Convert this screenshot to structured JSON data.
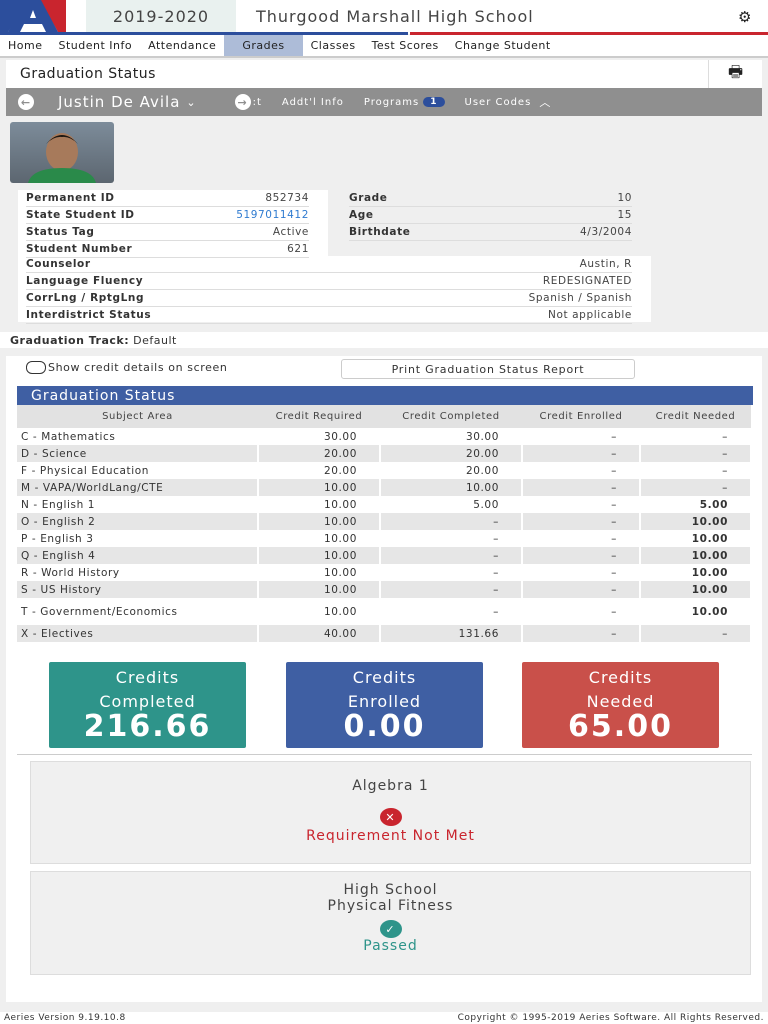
{
  "header": {
    "year": "2019-2020",
    "school": "Thurgood Marshall High School"
  },
  "nav": [
    "Home",
    "Student Info",
    "Attendance",
    "Grades",
    "Classes",
    "Test Scores",
    "Change Student"
  ],
  "page_title": "Graduation Status",
  "student_bar": {
    "name": "Justin De Avila",
    "contact_fragment": ":t",
    "addl_info": "Addt'l Info",
    "programs": "Programs",
    "programs_count": "1",
    "user_codes": "User Codes"
  },
  "info_left": [
    [
      "Permanent ID",
      "852734"
    ],
    [
      "State Student ID",
      "5197011412"
    ],
    [
      "Status Tag",
      "Active"
    ],
    [
      "Student Number",
      "621"
    ]
  ],
  "info_right": [
    [
      "Grade",
      "10"
    ],
    [
      "Age",
      "15"
    ],
    [
      "Birthdate",
      "4/3/2004"
    ]
  ],
  "info_wide": [
    [
      "Counselor",
      "Austin, R"
    ],
    [
      "Language Fluency",
      "REDESIGNATED"
    ],
    [
      "CorrLng / RptgLng",
      "Spanish / Spanish"
    ],
    [
      "Interdistrict Status",
      "Not applicable"
    ]
  ],
  "track": {
    "label": "Graduation Track:",
    "value": "Default"
  },
  "show_details": "Show credit details on screen",
  "print_report": "Print Graduation Status Report",
  "table": {
    "title": "Graduation Status",
    "headers": [
      "Subject Area",
      "Credit Required",
      "Credit Completed",
      "Credit Enrolled",
      "Credit Needed"
    ],
    "rows": [
      [
        "C - Mathematics",
        "30.00",
        "30.00",
        "–",
        "–"
      ],
      [
        "D - Science",
        "20.00",
        "20.00",
        "–",
        "–"
      ],
      [
        "F - Physical Education",
        "20.00",
        "20.00",
        "–",
        "–"
      ],
      [
        "M - VAPA/WorldLang/CTE",
        "10.00",
        "10.00",
        "–",
        "–"
      ],
      [
        "N - English 1",
        "10.00",
        "5.00",
        "–",
        "5.00"
      ],
      [
        "O - English 2",
        "10.00",
        "–",
        "–",
        "10.00"
      ],
      [
        "P - English 3",
        "10.00",
        "–",
        "–",
        "10.00"
      ],
      [
        "Q - English 4",
        "10.00",
        "–",
        "–",
        "10.00"
      ],
      [
        "R - World History",
        "10.00",
        "–",
        "–",
        "10.00"
      ],
      [
        "S - US History",
        "10.00",
        "–",
        "–",
        "10.00"
      ],
      [
        "T - Government/Economics",
        "10.00",
        "–",
        "–",
        "10.00"
      ],
      [
        "X - Electives",
        "40.00",
        "131.66",
        "–",
        "–"
      ]
    ]
  },
  "cards": [
    {
      "l1": "Credits",
      "l2": "Completed",
      "value": "216.66",
      "color": "#2e948a"
    },
    {
      "l1": "Credits",
      "l2": "Enrolled",
      "value": "0.00",
      "color": "#3f5fa3"
    },
    {
      "l1": "Credits",
      "l2": "Needed",
      "value": "65.00",
      "color": "#c9504a"
    }
  ],
  "requirements": [
    {
      "name": "Algebra 1",
      "status": "Requirement Not Met"
    },
    {
      "name1": "High School",
      "name2": "Physical Fitness",
      "status": "Passed"
    }
  ],
  "footer": {
    "version": "Aeries Version 9.19.10.8",
    "copyright": "Copyright © 1995-2019 Aeries Software. All Rights Reserved."
  }
}
